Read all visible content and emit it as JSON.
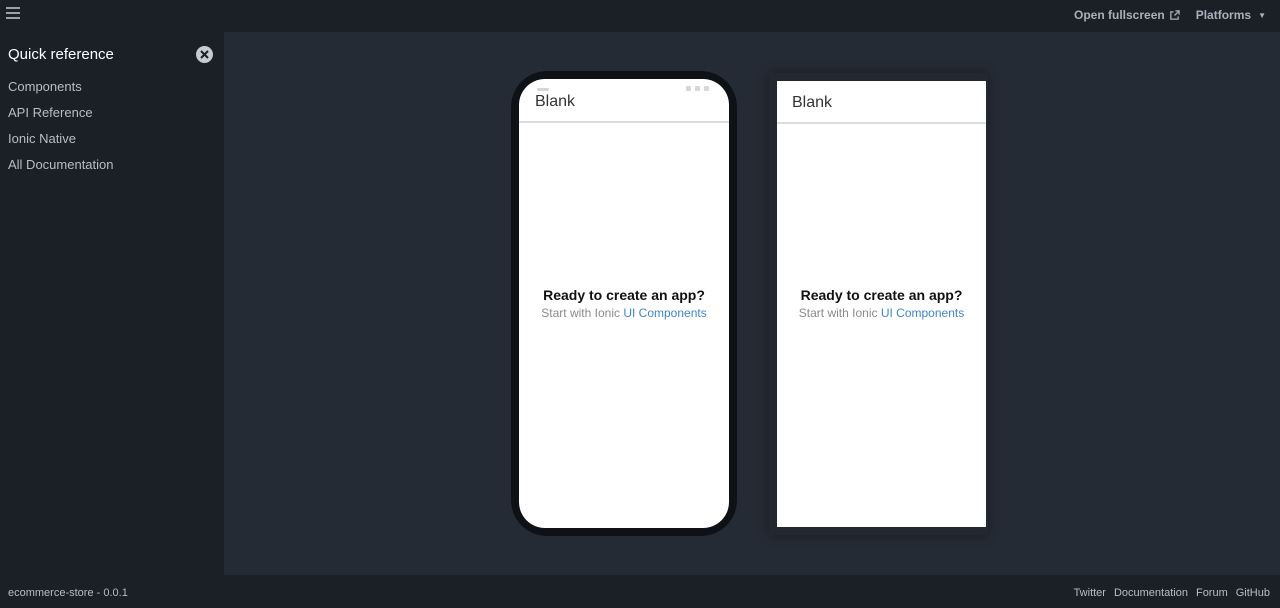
{
  "topbar": {
    "menu_icon": "hamburger-icon",
    "open_fullscreen": "Open fullscreen",
    "open_fullscreen_icon": "external-link-icon",
    "platforms": "Platforms",
    "platforms_icon": "caret-down-icon"
  },
  "sidebar": {
    "title": "Quick reference",
    "close_icon": "close-icon",
    "items": [
      {
        "label": "Components"
      },
      {
        "label": "API Reference"
      },
      {
        "label": "Ionic Native"
      },
      {
        "label": "All Documentation"
      }
    ]
  },
  "preview": {
    "ios": {
      "title": "Blank",
      "heading": "Ready to create an app?",
      "subtext": "Start with Ionic",
      "link": "UI Components"
    },
    "android": {
      "title": "Blank",
      "heading": "Ready to create an app?",
      "subtext": "Start with Ionic",
      "link": "UI Components"
    }
  },
  "footer": {
    "project": "ecommerce-store - 0.0.1",
    "links": [
      "Twitter",
      "Documentation",
      "Forum",
      "GitHub"
    ]
  },
  "colors": {
    "background": "#1b1f26",
    "main": "#252b34",
    "link": "#3d86c7"
  }
}
